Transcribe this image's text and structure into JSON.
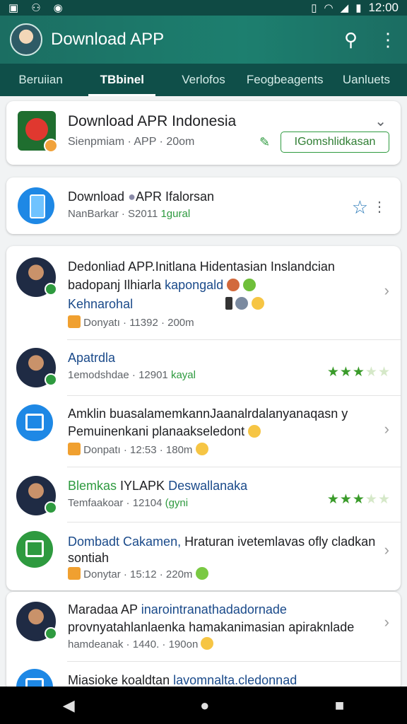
{
  "status_bar": {
    "time": "12:00"
  },
  "app_bar": {
    "title": "Download APP"
  },
  "tabs": [
    {
      "label": "Beruiian"
    },
    {
      "label": "TBbinel"
    },
    {
      "label": "Verlofos"
    },
    {
      "label": "Feogbeagents"
    },
    {
      "label": "Uanluets"
    }
  ],
  "featured": {
    "title": "Download APR Indonesia",
    "subtitle": "Sienpmiam · APP · 20om",
    "button_label": "IGomshlidkasan"
  },
  "second_card": {
    "title": "Download ",
    "title_rest": "APR Ifalorsan",
    "sub_a": "NanBarkar · ",
    "sub_b": "S2011 ",
    "sub_c": "1gural"
  },
  "list": [
    {
      "line1": "Dedonliad APP.Initlana Hidentasian Inslandcian",
      "line2a": "badopanj Ilhiarla ",
      "line2b": "kapongald",
      "line3": "Kehnarohal",
      "meta": "Donyatı · 11392 · 200m"
    },
    {
      "line1": "Apatrdla",
      "meta_a": "1emodshdae · 12901 ",
      "meta_b": "kayal"
    },
    {
      "line1": "Amklin buasalamemkannJaanalrdalanyanaqasn y",
      "line2": "Pemuinenkani planaakseledont",
      "meta": "Donpatı · 12:53 · 180m"
    },
    {
      "line1a": "Blemkas ",
      "line1b": "IYLAPK ",
      "line1c": "Deswallanaka",
      "meta_a": "Temfaakoar · 12104 ",
      "meta_b": "(gyni"
    },
    {
      "line1a": "Dombadt Cakamen, ",
      "line1b": "Hraturan ivetemlavas ofly cladkan",
      "line2": "sontiah",
      "meta": "Donytar · 15:12 · 220m"
    }
  ],
  "bottom_list": [
    {
      "line1a": "Maradaa AP ",
      "line1b": "inarointranathadadornade",
      "line2": "provnyatahlanlaenka hamakanimasian apiraknlade",
      "meta": "hamdeanak · 1440. · 190on"
    },
    {
      "line1a": "Miasioke koaldtan ",
      "line1b": "lavomnalta.cledonnad"
    }
  ]
}
